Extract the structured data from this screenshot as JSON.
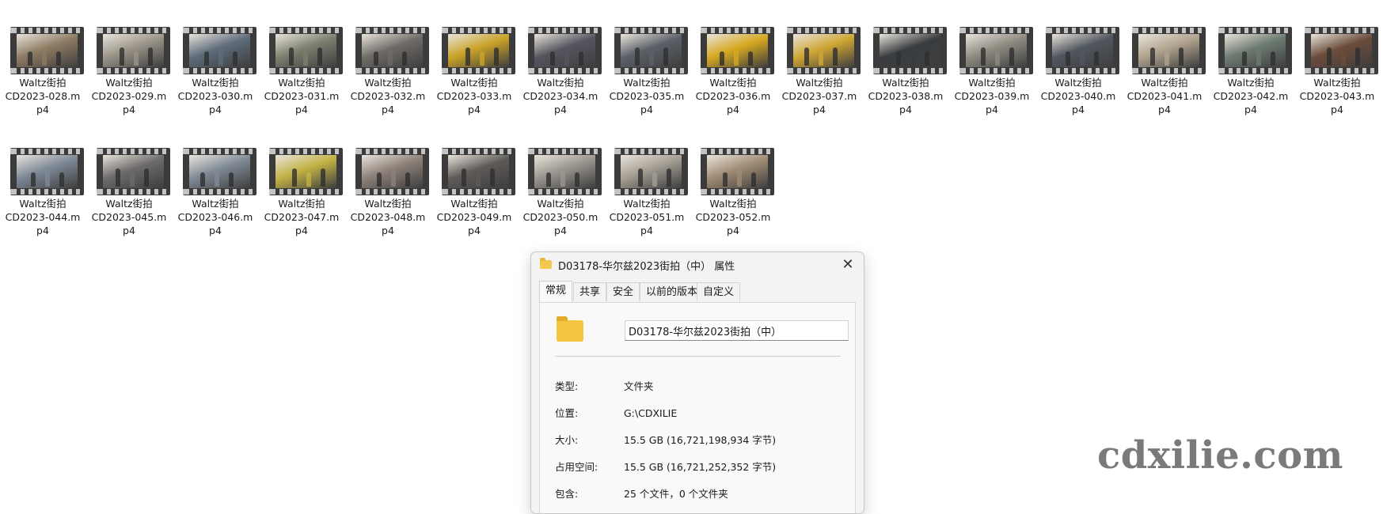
{
  "files": [
    {
      "line1": "Waltz街拍",
      "line2": "CD2023-028.m",
      "line3": "p4"
    },
    {
      "line1": "Waltz街拍",
      "line2": "CD2023-029.m",
      "line3": "p4"
    },
    {
      "line1": "Waltz街拍",
      "line2": "CD2023-030.m",
      "line3": "p4"
    },
    {
      "line1": "Waltz街拍",
      "line2": "CD2023-031.m",
      "line3": "p4"
    },
    {
      "line1": "Waltz街拍",
      "line2": "CD2023-032.m",
      "line3": "p4"
    },
    {
      "line1": "Waltz街拍",
      "line2": "CD2023-033.m",
      "line3": "p4"
    },
    {
      "line1": "Waltz街拍",
      "line2": "CD2023-034.m",
      "line3": "p4"
    },
    {
      "line1": "Waltz街拍",
      "line2": "CD2023-035.m",
      "line3": "p4"
    },
    {
      "line1": "Waltz街拍",
      "line2": "CD2023-036.m",
      "line3": "p4"
    },
    {
      "line1": "Waltz街拍",
      "line2": "CD2023-037.m",
      "line3": "p4"
    },
    {
      "line1": "Waltz街拍",
      "line2": "CD2023-038.m",
      "line3": "p4"
    },
    {
      "line1": "Waltz街拍",
      "line2": "CD2023-039.m",
      "line3": "p4"
    },
    {
      "line1": "Waltz街拍",
      "line2": "CD2023-040.m",
      "line3": "p4"
    },
    {
      "line1": "Waltz街拍",
      "line2": "CD2023-041.m",
      "line3": "p4"
    },
    {
      "line1": "Waltz街拍",
      "line2": "CD2023-042.m",
      "line3": "p4"
    },
    {
      "line1": "Waltz街拍",
      "line2": "CD2023-043.m",
      "line3": "p4"
    },
    {
      "line1": "Waltz街拍",
      "line2": "CD2023-044.m",
      "line3": "p4"
    },
    {
      "line1": "Waltz街拍",
      "line2": "CD2023-045.m",
      "line3": "p4"
    },
    {
      "line1": "Waltz街拍",
      "line2": "CD2023-046.m",
      "line3": "p4"
    },
    {
      "line1": "Waltz街拍",
      "line2": "CD2023-047.m",
      "line3": "p4"
    },
    {
      "line1": "Waltz街拍",
      "line2": "CD2023-048.m",
      "line3": "p4"
    },
    {
      "line1": "Waltz街拍",
      "line2": "CD2023-049.m",
      "line3": "p4"
    },
    {
      "line1": "Waltz街拍",
      "line2": "CD2023-050.m",
      "line3": "p4"
    },
    {
      "line1": "Waltz街拍",
      "line2": "CD2023-051.m",
      "line3": "p4"
    },
    {
      "line1": "Waltz街拍",
      "line2": "CD2023-052.m",
      "line3": "p4"
    }
  ],
  "thumbnail_icon": "video-file-icon",
  "thumbnail_colors": [
    "#8d7b62",
    "#9a9488",
    "#5d6b7a",
    "#7a7f6e",
    "#6e6a66",
    "#c9a227",
    "#55555f",
    "#5b6068",
    "#d6a820",
    "#cfa634",
    "#3a3d40",
    "#8e8a80",
    "#50565e",
    "#b0a38e",
    "#6c7a70",
    "#6b4c3a",
    "#7d8896",
    "#6c6a6a",
    "#7f8a96",
    "#c2b245",
    "#8c8078",
    "#5e5a58",
    "#9a958e",
    "#a39d92",
    "#a08c74"
  ],
  "dialog": {
    "title": "D03178-华尔兹2023街拍（中） 属性",
    "close_glyph": "✕",
    "tabs": [
      "常规",
      "共享",
      "安全",
      "以前的版本",
      "自定义"
    ],
    "active_tab": "常规",
    "folder_name": "D03178-华尔兹2023街拍（中）",
    "folder_color": "#f4c53e",
    "properties": [
      {
        "key": "类型:",
        "value": "文件夹"
      },
      {
        "key": "位置:",
        "value": "G:\\CDXILIE"
      },
      {
        "key": "大小:",
        "value": "15.5 GB (16,721,198,934 字节)"
      },
      {
        "key": "占用空间:",
        "value": "15.5 GB (16,721,252,352 字节)"
      },
      {
        "key": "包含:",
        "value": "25 个文件，0 个文件夹"
      }
    ]
  },
  "watermark": "cdxilie.com"
}
